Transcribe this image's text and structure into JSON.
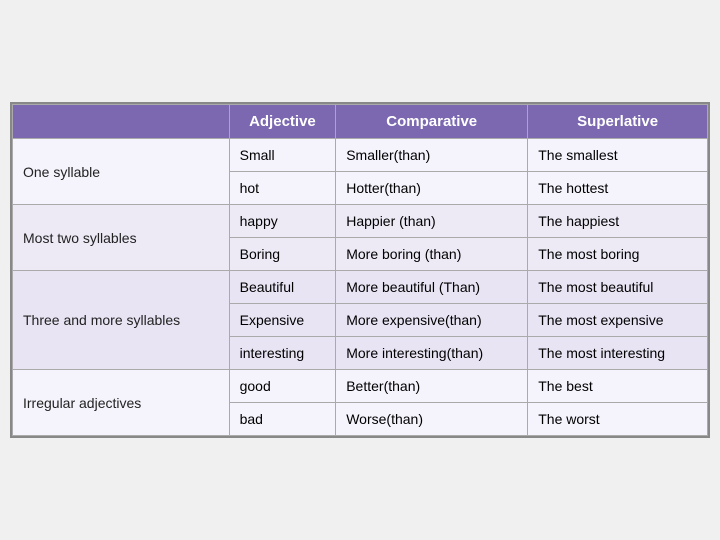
{
  "header": {
    "col0": "",
    "col1": "Adjective",
    "col2": "Comparative",
    "col3": "Superlative"
  },
  "groups": [
    {
      "category": "One syllable",
      "rows": [
        {
          "adj": "Small",
          "comp": "Smaller(than)",
          "super": "The smallest"
        },
        {
          "adj": "hot",
          "comp": "Hotter(than)",
          "super": "The hottest"
        }
      ]
    },
    {
      "category": "Most  two syllables",
      "rows": [
        {
          "adj": "happy",
          "comp": "Happier (than)",
          "super": "The happiest"
        },
        {
          "adj": "Boring",
          "comp": "More boring (than)",
          "super": "The most boring"
        }
      ]
    },
    {
      "category": "Three and more syllables",
      "rows": [
        {
          "adj": "Beautiful",
          "comp": "More beautiful (Than)",
          "super": "The most beautiful"
        },
        {
          "adj": "Expensive",
          "comp": "More expensive(than)",
          "super": "The most expensive"
        },
        {
          "adj": "interesting",
          "comp": "More interesting(than)",
          "super": "The most interesting"
        }
      ]
    },
    {
      "category": "Irregular adjectives",
      "rows": [
        {
          "adj": "good",
          "comp": "Better(than)",
          "super": "The best"
        },
        {
          "adj": "bad",
          "comp": "Worse(than)",
          "super": "The worst"
        }
      ]
    }
  ]
}
